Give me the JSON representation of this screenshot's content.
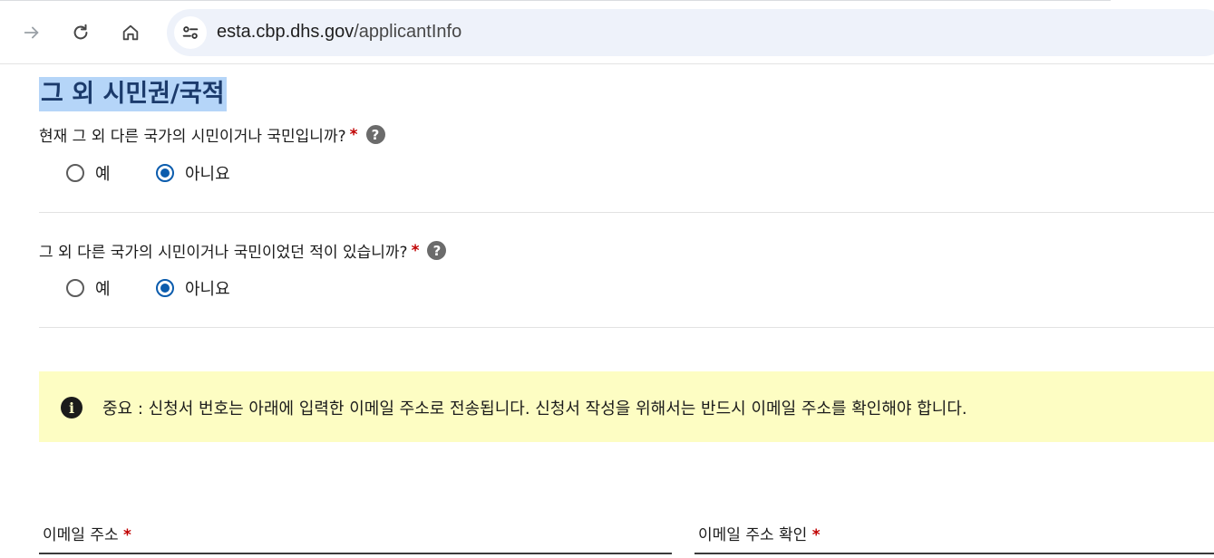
{
  "browser": {
    "url_host": "esta.cbp.dhs.gov",
    "url_path": "/applicantInfo"
  },
  "section": {
    "title": "그 외 시민권/국적"
  },
  "questions": [
    {
      "text": "현재 그 외 다른 국가의 시민이거나 국민입니까?",
      "required_mark": "*",
      "help_icon": "question-circle-icon",
      "options": [
        "예",
        "아니요"
      ],
      "selected": "아니요"
    },
    {
      "text": "그 외 다른 국가의 시민이거나 국민이었던 적이 있습니까?",
      "required_mark": "*",
      "help_icon": "question-circle-icon",
      "options": [
        "예",
        "아니요"
      ],
      "selected": "아니요"
    }
  ],
  "notice": {
    "icon": "info-circle-icon",
    "text": "중요 : 신청서 번호는 아래에 입력한 이메일 주소로 전송됩니다. 신청서 작성을 위해서는 반드시 이메일 주소를 확인해야 합니다."
  },
  "fields": {
    "email_label": "이메일 주소",
    "email_confirm_label": "이메일 주소 확인",
    "required_mark": "*"
  },
  "colors": {
    "accent": "#0b5cad",
    "required": "#c00000",
    "notice_bg": "#fdfdc3",
    "title_highlight": "#b5d5f8"
  }
}
